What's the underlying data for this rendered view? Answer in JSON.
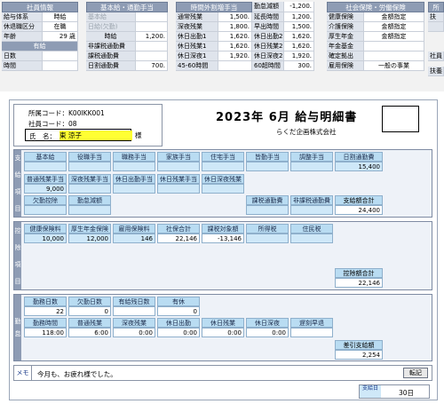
{
  "employee_panel": {
    "title": "社員情報",
    "rows": [
      {
        "label": "給与体系",
        "value": "時給"
      },
      {
        "label": "休退職区分",
        "value": "在職"
      },
      {
        "label": "年齢",
        "value": "29 歳"
      }
    ],
    "sub_title": "有給",
    "sub_rows": [
      {
        "label": "日数",
        "value": ""
      },
      {
        "label": "時間",
        "value": ""
      }
    ]
  },
  "base_panel": {
    "title": "基本給・通勤手当",
    "rows": [
      {
        "label": "基本給",
        "value": ""
      },
      {
        "label": "日給(欠勤)",
        "value": ""
      },
      {
        "label": "時給",
        "value": "1,200."
      },
      {
        "label": "非課税通勤費",
        "value": ""
      },
      {
        "label": "課税通勤費",
        "value": ""
      },
      {
        "label": "日割通勤費",
        "value": "700."
      }
    ]
  },
  "overtime_panel": {
    "title": "時間外割増手当",
    "left": [
      {
        "label": "通常残業",
        "value": "1,500."
      },
      {
        "label": "深夜残業",
        "value": "1,800."
      },
      {
        "label": "休日出勤1",
        "value": "1,620."
      },
      {
        "label": "休日残業1",
        "value": "1,620."
      },
      {
        "label": "休日深夜1",
        "value": "1,920."
      },
      {
        "label": "45-60時間",
        "value": ""
      }
    ],
    "right": [
      {
        "label": "勤怠減額",
        "value": "-1,200."
      },
      {
        "label": "延長時間",
        "value": "1,200."
      },
      {
        "label": "早出時間",
        "value": "1,500."
      },
      {
        "label": "休日出勤2",
        "value": "1,620."
      },
      {
        "label": "休日残業2",
        "value": "1,620."
      },
      {
        "label": "休日深夜2",
        "value": "1,920."
      },
      {
        "label": "60超時間",
        "value": "300."
      }
    ]
  },
  "insurance_panel": {
    "title": "社会保険・労働保険",
    "rows": [
      {
        "label": "健康保険",
        "value": "金額指定"
      },
      {
        "label": "介護保険",
        "value": "金額指定"
      },
      {
        "label": "厚生年金",
        "value": "金額指定"
      },
      {
        "label": "年金基金",
        "value": ""
      },
      {
        "label": "確定拠出",
        "value": ""
      },
      {
        "label": "雇用保険",
        "value": "一般の事業"
      }
    ]
  },
  "extra_panel": {
    "title": "所",
    "rows": [
      "扶",
      "",
      "社員",
      "扶養"
    ]
  },
  "slip": {
    "code_label": "所属コード：",
    "code_value": "K00IKK001",
    "emp_label": "社員コード：",
    "emp_value": "08",
    "name_label": "氏　名：",
    "name_value": "東 涼子",
    "sama": "様",
    "title": "2023年 6月 給与明細書",
    "company": "らくだ企画株式会社"
  },
  "payments": {
    "side_label": [
      "支",
      "給",
      "項",
      "目"
    ],
    "row1_headers": [
      "基本給",
      "役職手当",
      "職務手当",
      "家族手当",
      "住宅手当",
      "皆勤手当",
      "調整手当",
      "日割通勤費"
    ],
    "row1_values": [
      "",
      "",
      "",
      "",
      "",
      "",
      "",
      "15,400"
    ],
    "row2_headers": [
      "普通残業手当",
      "深夜残業手当",
      "休日出勤手当",
      "休日残業手当",
      "休日深夜残業"
    ],
    "row2_values": [
      "9,000",
      "",
      "",
      "",
      ""
    ],
    "row3_headers": [
      "欠勤控除",
      "勤怠減額",
      "",
      "",
      "",
      "課税通勤費",
      "非課税通勤費",
      "支給額合計"
    ],
    "row3_values": [
      "",
      "",
      "",
      "",
      "",
      "",
      "",
      "24,400"
    ]
  },
  "deductions": {
    "side_label": [
      "控",
      "除",
      "項",
      "目"
    ],
    "headers": [
      "健康保険料",
      "厚生年金保険",
      "雇用保険料",
      "社保合計",
      "課税対象額",
      "所得税",
      "住民税"
    ],
    "values": [
      "10,000",
      "12,000",
      "146",
      "22,146",
      "-13,146",
      "",
      ""
    ],
    "total_label": "控除額合計",
    "total_value": "22,146"
  },
  "attendance": {
    "side_label": [
      "勤",
      "怠"
    ],
    "row1_headers": [
      "勤務日数",
      "欠勤日数",
      "有給残日数",
      "有休"
    ],
    "row1_values": [
      "22",
      "0",
      "",
      "0"
    ],
    "row2_headers": [
      "勤務時間",
      "普通残業",
      "深夜残業",
      "休日出勤",
      "休日残業",
      "休日深夜",
      "遅刻早退"
    ],
    "row2_values": [
      "118:00",
      "6:00",
      "0:00",
      "0:00",
      "0:00",
      "0:00",
      ""
    ],
    "net_label": "差引支給額",
    "net_value": "2,254"
  },
  "memo": {
    "label": "メモ",
    "text": "今月も、お疲れ様でした。",
    "button": "転記"
  },
  "pay_date": {
    "label": "支給日",
    "value": "30日"
  }
}
